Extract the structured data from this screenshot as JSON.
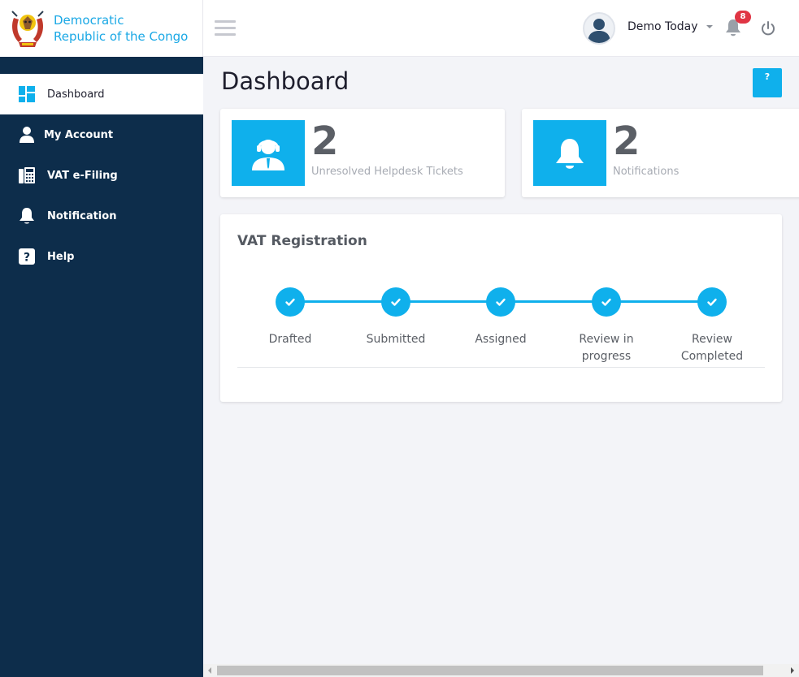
{
  "brand": {
    "line1": "Democratic",
    "line2": "Republic of the Congo",
    "logo_icon": "congo-coat-of-arms"
  },
  "sidebar": {
    "items": [
      {
        "label": "Dashboard",
        "icon": "dashboard-icon",
        "active": true
      },
      {
        "label": "My Account",
        "icon": "user-icon",
        "active": false
      },
      {
        "label": "VAT e-Filing",
        "icon": "calculator-icon",
        "active": false
      },
      {
        "label": "Notification",
        "icon": "bell-icon",
        "active": false
      },
      {
        "label": "Help",
        "icon": "question-icon",
        "active": false
      }
    ]
  },
  "header": {
    "username": "Demo Today",
    "notification_count": "8"
  },
  "main": {
    "title": "Dashboard",
    "help_label": "?",
    "stats": [
      {
        "value": "2",
        "label": "Unresolved Helpdesk Tickets",
        "icon": "headset-agent-icon"
      },
      {
        "value": "2",
        "label": "Notifications",
        "icon": "bell-icon"
      }
    ],
    "vat": {
      "title": "VAT Registration",
      "steps": [
        {
          "label": "Drafted",
          "done": true
        },
        {
          "label": "Submitted",
          "done": true
        },
        {
          "label": "Assigned",
          "done": true
        },
        {
          "label": "Review in progress",
          "done": true
        },
        {
          "label": "Review Completed",
          "done": true
        }
      ]
    }
  },
  "colors": {
    "accent": "#0fb0ec",
    "sidebar": "#0d2d4b",
    "brand_text": "#1aa8e5",
    "badge": "#e03544"
  }
}
